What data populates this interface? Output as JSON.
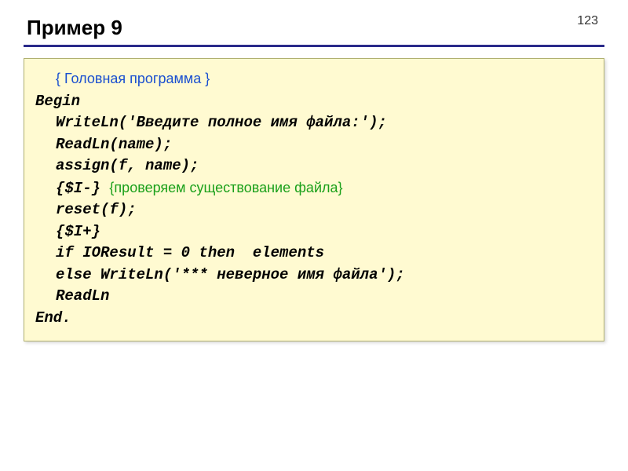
{
  "page_number": "123",
  "title": "Пример 9",
  "code": {
    "c1": "{ Головная программа }",
    "l1": "Begin",
    "l2": "WriteLn('Введите полное имя файла:');",
    "l3": "ReadLn(name);",
    "l4": "assign(f, name);",
    "l5a": "{$I-}",
    "c2": "{проверяем существование файла}",
    "l6": "reset(f);",
    "l7": "{$I+}",
    "l8": "if IOResult = 0 then  elements",
    "l9": "else WriteLn('*** неверное имя файла');",
    "l10": "ReadLn",
    "l11": "End."
  }
}
